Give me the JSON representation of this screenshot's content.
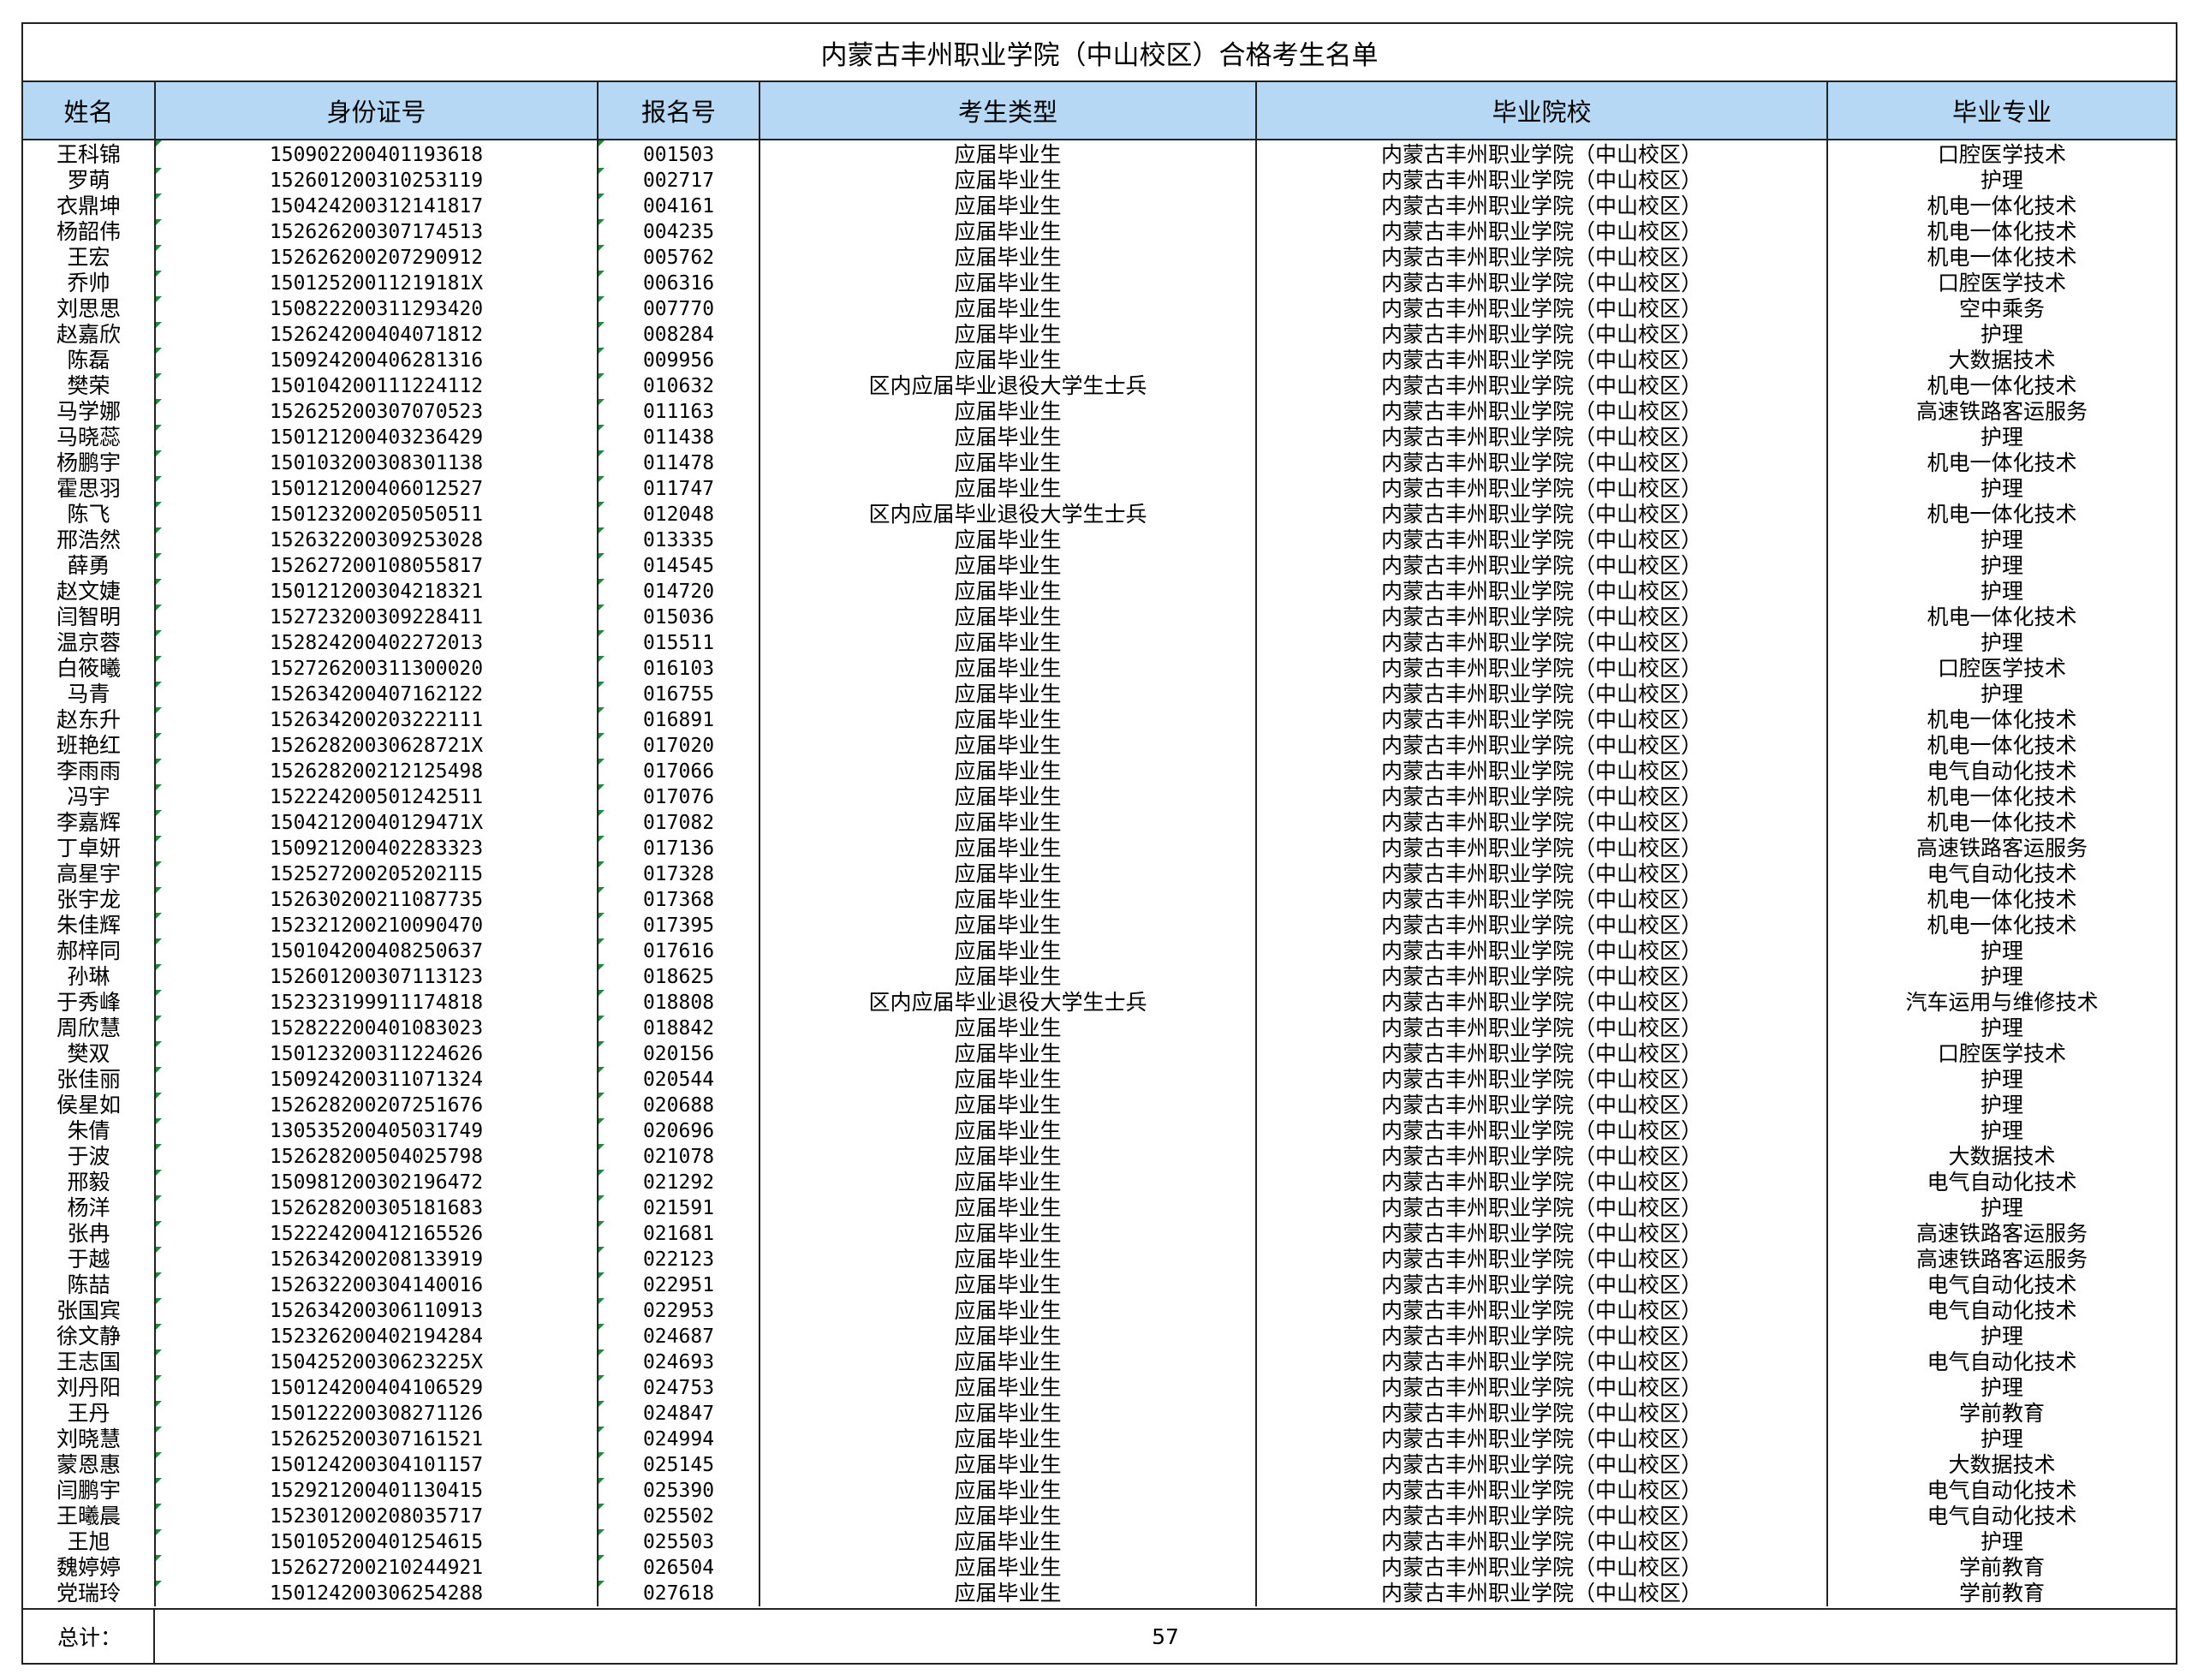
{
  "title": "内蒙古丰州职业学院（中山校区）合格考生名单",
  "columns": [
    "姓名",
    "身份证号",
    "报名号",
    "考生类型",
    "毕业院校",
    "毕业专业"
  ],
  "rows": [
    [
      "王科锦",
      "150902200401193618",
      "001503",
      "应届毕业生",
      "内蒙古丰州职业学院（中山校区）",
      "口腔医学技术"
    ],
    [
      "罗萌",
      "152601200310253119",
      "002717",
      "应届毕业生",
      "内蒙古丰州职业学院（中山校区）",
      "护理"
    ],
    [
      "衣鼎坤",
      "150424200312141817",
      "004161",
      "应届毕业生",
      "内蒙古丰州职业学院（中山校区）",
      "机电一体化技术"
    ],
    [
      "杨韶伟",
      "152626200307174513",
      "004235",
      "应届毕业生",
      "内蒙古丰州职业学院（中山校区）",
      "机电一体化技术"
    ],
    [
      "王宏",
      "152626200207290912",
      "005762",
      "应届毕业生",
      "内蒙古丰州职业学院（中山校区）",
      "机电一体化技术"
    ],
    [
      "乔帅",
      "150125200112191​81X",
      "006316",
      "应届毕业生",
      "内蒙古丰州职业学院（中山校区）",
      "口腔医学技术"
    ],
    [
      "刘思思",
      "150822200311293420",
      "007770",
      "应届毕业生",
      "内蒙古丰州职业学院（中山校区）",
      "空中乘务"
    ],
    [
      "赵嘉欣",
      "152624200404071812",
      "008284",
      "应届毕业生",
      "内蒙古丰州职业学院（中山校区）",
      "护理"
    ],
    [
      "陈磊",
      "150924200406281316",
      "009956",
      "应届毕业生",
      "内蒙古丰州职业学院（中山校区）",
      "大数据技术"
    ],
    [
      "樊荣",
      "150104200111224112",
      "010632",
      "区内应届毕业退役大学生士兵",
      "内蒙古丰州职业学院（中山校区）",
      "机电一体化技术"
    ],
    [
      "马学娜",
      "152625200307070523",
      "011163",
      "应届毕业生",
      "内蒙古丰州职业学院（中山校区）",
      "高速铁路客运服务"
    ],
    [
      "马晓蕊",
      "150121200403236429",
      "011438",
      "应届毕业生",
      "内蒙古丰州职业学院（中山校区）",
      "护理"
    ],
    [
      "杨鹏宇",
      "150103200308301138",
      "011478",
      "应届毕业生",
      "内蒙古丰州职业学院（中山校区）",
      "机电一体化技术"
    ],
    [
      "霍思羽",
      "150121200406012527",
      "011747",
      "应届毕业生",
      "内蒙古丰州职业学院（中山校区）",
      "护理"
    ],
    [
      "陈飞",
      "150123200205050511",
      "012048",
      "区内应届毕业退役大学生士兵",
      "内蒙古丰州职业学院（中山校区）",
      "机电一体化技术"
    ],
    [
      "邢浩然",
      "152632200309253028",
      "013335",
      "应届毕业生",
      "内蒙古丰州职业学院（中山校区）",
      "护理"
    ],
    [
      "薛勇",
      "152627200108055817",
      "014545",
      "应届毕业生",
      "内蒙古丰州职业学院（中山校区）",
      "护理"
    ],
    [
      "赵文婕",
      "150121200304218321",
      "014720",
      "应届毕业生",
      "内蒙古丰州职业学院（中山校区）",
      "护理"
    ],
    [
      "闫智明",
      "152723200309228411",
      "015036",
      "应届毕业生",
      "内蒙古丰州职业学院（中山校区）",
      "机电一体化技术"
    ],
    [
      "温京蓉",
      "152824200402272013",
      "015511",
      "应届毕业生",
      "内蒙古丰州职业学院（中山校区）",
      "护理"
    ],
    [
      "白筱曦",
      "152726200311300020",
      "016103",
      "应届毕业生",
      "内蒙古丰州职业学院（中山校区）",
      "口腔医学技术"
    ],
    [
      "马青",
      "152634200407162122",
      "016755",
      "应届毕业生",
      "内蒙古丰州职业学院（中山校区）",
      "护理"
    ],
    [
      "赵东升",
      "152634200203222111",
      "016891",
      "应届毕业生",
      "内蒙古丰州职业学院（中山校区）",
      "机电一体化技术"
    ],
    [
      "班艳红",
      "15262820030628721X",
      "017020",
      "应届毕业生",
      "内蒙古丰州职业学院（中山校区）",
      "机电一体化技术"
    ],
    [
      "李雨雨",
      "152628200212125498",
      "017066",
      "应届毕业生",
      "内蒙古丰州职业学院（中山校区）",
      "电气自动化技术"
    ],
    [
      "冯宇",
      "152224200501242511",
      "017076",
      "应届毕业生",
      "内蒙古丰州职业学院（中山校区）",
      "机电一体化技术"
    ],
    [
      "李嘉辉",
      "15042120040129471X",
      "017082",
      "应届毕业生",
      "内蒙古丰州职业学院（中山校区）",
      "机电一体化技术"
    ],
    [
      "丁卓妍",
      "150921200402283323",
      "017136",
      "应届毕业生",
      "内蒙古丰州职业学院（中山校区）",
      "高速铁路客运服务"
    ],
    [
      "高星宇",
      "152527200205202115",
      "017328",
      "应届毕业生",
      "内蒙古丰州职业学院（中山校区）",
      "电气自动化技术"
    ],
    [
      "张宇龙",
      "152630200211087735",
      "017368",
      "应届毕业生",
      "内蒙古丰州职业学院（中山校区）",
      "机电一体化技术"
    ],
    [
      "朱佳辉",
      "152321200210090470",
      "017395",
      "应届毕业生",
      "内蒙古丰州职业学院（中山校区）",
      "机电一体化技术"
    ],
    [
      "郝梓同",
      "150104200408250637",
      "017616",
      "应届毕业生",
      "内蒙古丰州职业学院（中山校区）",
      "护理"
    ],
    [
      "孙琳",
      "152601200307113123",
      "018625",
      "应届毕业生",
      "内蒙古丰州职业学院（中山校区）",
      "护理"
    ],
    [
      "于秀峰",
      "152323199911174818",
      "018808",
      "区内应届毕业退役大学生士兵",
      "内蒙古丰州职业学院（中山校区）",
      "汽车运用与维修技术"
    ],
    [
      "周欣慧",
      "152822200401083023",
      "018842",
      "应届毕业生",
      "内蒙古丰州职业学院（中山校区）",
      "护理"
    ],
    [
      "樊双",
      "150123200311224626",
      "020156",
      "应届毕业生",
      "内蒙古丰州职业学院（中山校区）",
      "口腔医学技术"
    ],
    [
      "张佳丽",
      "150924200311071324",
      "020544",
      "应届毕业生",
      "内蒙古丰州职业学院（中山校区）",
      "护理"
    ],
    [
      "侯星如",
      "152628200207251676",
      "020688",
      "应届毕业生",
      "内蒙古丰州职业学院（中山校区）",
      "护理"
    ],
    [
      "朱倩",
      "130535200405031749",
      "020696",
      "应届毕业生",
      "内蒙古丰州职业学院（中山校区）",
      "护理"
    ],
    [
      "于波",
      "152628200504025798",
      "021078",
      "应届毕业生",
      "内蒙古丰州职业学院（中山校区）",
      "大数据技术"
    ],
    [
      "邢毅",
      "150981200302196472",
      "021292",
      "应届毕业生",
      "内蒙古丰州职业学院（中山校区）",
      "电气自动化技术"
    ],
    [
      "杨洋",
      "152628200305181683",
      "021591",
      "应届毕业生",
      "内蒙古丰州职业学院（中山校区）",
      "护理"
    ],
    [
      "张冉",
      "152224200412165526",
      "021681",
      "应届毕业生",
      "内蒙古丰州职业学院（中山校区）",
      "高速铁路客运服务"
    ],
    [
      "于越",
      "152634200208133919",
      "022123",
      "应届毕业生",
      "内蒙古丰州职业学院（中山校区）",
      "高速铁路客运服务"
    ],
    [
      "陈喆",
      "152632200304140016",
      "022951",
      "应届毕业生",
      "内蒙古丰州职业学院（中山校区）",
      "电气自动化技术"
    ],
    [
      "张国宾",
      "152634200306110913",
      "022953",
      "应届毕业生",
      "内蒙古丰州职业学院（中山校区）",
      "电气自动化技术"
    ],
    [
      "徐文静",
      "152326200402194284",
      "024687",
      "应届毕业生",
      "内蒙古丰州职业学院（中山校区）",
      "护理"
    ],
    [
      "王志国",
      "15042520030623225X",
      "024693",
      "应届毕业生",
      "内蒙古丰州职业学院（中山校区）",
      "电气自动化技术"
    ],
    [
      "刘丹阳",
      "150124200404106529",
      "024753",
      "应届毕业生",
      "内蒙古丰州职业学院（中山校区）",
      "护理"
    ],
    [
      "王丹",
      "150122200308271126",
      "024847",
      "应届毕业生",
      "内蒙古丰州职业学院（中山校区）",
      "学前教育"
    ],
    [
      "刘晓慧",
      "152625200307161521",
      "024994",
      "应届毕业生",
      "内蒙古丰州职业学院（中山校区）",
      "护理"
    ],
    [
      "蒙恩惠",
      "150124200304101157",
      "025145",
      "应届毕业生",
      "内蒙古丰州职业学院（中山校区）",
      "大数据技术"
    ],
    [
      "闫鹏宇",
      "152921200401130415",
      "025390",
      "应届毕业生",
      "内蒙古丰州职业学院（中山校区）",
      "电气自动化技术"
    ],
    [
      "王曦晨",
      "152301200208035717",
      "025502",
      "应届毕业生",
      "内蒙古丰州职业学院（中山校区）",
      "电气自动化技术"
    ],
    [
      "王旭",
      "150105200401254615",
      "025503",
      "应届毕业生",
      "内蒙古丰州职业学院（中山校区）",
      "护理"
    ],
    [
      "魏婷婷",
      "152627200210244921",
      "026504",
      "应届毕业生",
      "内蒙古丰州职业学院（中山校区）",
      "学前教育"
    ],
    [
      "党瑞玲",
      "150124200306254288",
      "027618",
      "应届毕业生",
      "内蒙古丰州职业学院（中山校区）",
      "学前教育"
    ]
  ],
  "footer": {
    "label": "总计：",
    "value": "57"
  },
  "colors": {
    "header_bg": "#b7d8f5",
    "border": "#222222",
    "cell_marker": "#1e8a3a"
  }
}
